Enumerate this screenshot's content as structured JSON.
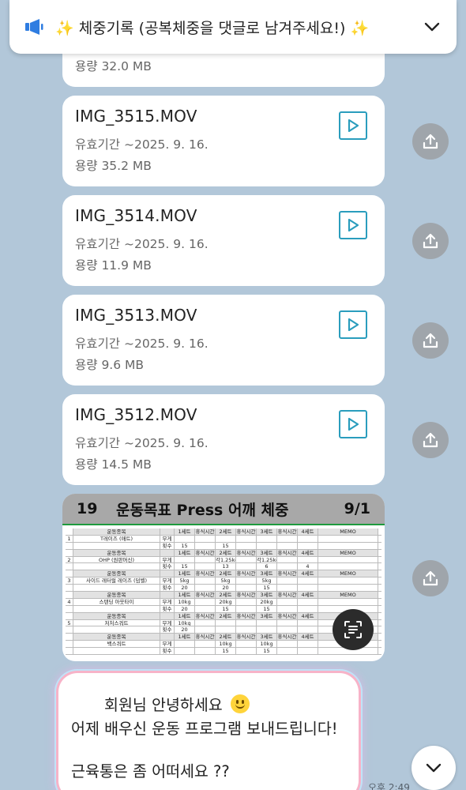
{
  "notice": {
    "text": "✨ 체중기록 (공복체중을 댓글로 남겨주세요!) ✨"
  },
  "top_file": {
    "size": "용량 32.0 MB"
  },
  "files": [
    {
      "name": "IMG_3515.MOV",
      "expiry": "유효기간 ~2025. 9. 16.",
      "size": "용량 35.2 MB"
    },
    {
      "name": "IMG_3514.MOV",
      "expiry": "유효기간 ~2025. 9. 16.",
      "size": "용량 11.9 MB"
    },
    {
      "name": "IMG_3513.MOV",
      "expiry": "유효기간 ~2025. 9. 16.",
      "size": "용량 9.6 MB"
    },
    {
      "name": "IMG_3512.MOV",
      "expiry": "유효기간 ~2025. 9. 16.",
      "size": "용량 14.5 MB"
    }
  ],
  "image_message": {
    "header_num": "19",
    "header_goal": "운동목표  Press 어깨  체중",
    "header_date": "9/1",
    "rows": [
      [
        "",
        "운동종목",
        "",
        "1세트",
        "휴식시간",
        "2세트",
        "휴식시간",
        "3세트",
        "휴식시간",
        "4세트",
        "MEMO"
      ],
      [
        "1",
        "T레이즈 (매트)",
        "무게",
        "",
        "",
        "",
        "",
        "",
        "",
        "",
        ""
      ],
      [
        "",
        "",
        "횟수",
        "15",
        "",
        "15",
        "",
        "",
        "",
        "",
        ""
      ],
      [
        "",
        "운동종목",
        "",
        "1세트",
        "휴식시간",
        "2세트",
        "휴식시간",
        "3세트",
        "휴식시간",
        "4세트",
        "MEMO"
      ],
      [
        "2",
        "OHP (원판머신)",
        "무게",
        "",
        "",
        "각1.25kg",
        "",
        "각1.25kg",
        "",
        "",
        ""
      ],
      [
        "",
        "",
        "횟수",
        "15",
        "",
        "13",
        "",
        "6",
        "",
        "4",
        ""
      ],
      [
        "",
        "운동종목",
        "",
        "1세트",
        "휴식시간",
        "2세트",
        "휴식시간",
        "3세트",
        "휴식시간",
        "4세트",
        "MEMO"
      ],
      [
        "3",
        "사이드 레터럴 레이즈 (덤벨)",
        "무게",
        "5kg",
        "",
        "5kg",
        "",
        "5kg",
        "",
        "",
        ""
      ],
      [
        "",
        "",
        "횟수",
        "20",
        "",
        "20",
        "",
        "15",
        "",
        "",
        ""
      ],
      [
        "",
        "운동종목",
        "",
        "1세트",
        "휴식시간",
        "2세트",
        "휴식시간",
        "3세트",
        "휴식시간",
        "4세트",
        "MEMO"
      ],
      [
        "4",
        "스탠딩 아웃타이",
        "무게",
        "10kg",
        "",
        "20kg",
        "",
        "20kg",
        "",
        "",
        ""
      ],
      [
        "",
        "",
        "횟수",
        "20",
        "",
        "15",
        "",
        "15",
        "",
        "",
        ""
      ],
      [
        "",
        "운동종목",
        "",
        "1세트",
        "휴식시간",
        "2세트",
        "휴식시간",
        "3세트",
        "휴식시간",
        "4세트",
        "MEMO"
      ],
      [
        "5",
        "저처스쿼트",
        "무게",
        "10kg",
        "",
        "",
        "",
        "",
        "",
        "",
        ""
      ],
      [
        "",
        "",
        "횟수",
        "20",
        "",
        "",
        "",
        "",
        "",
        "",
        ""
      ],
      [
        "",
        "운동종목",
        "",
        "1세트",
        "휴식시간",
        "2세트",
        "휴식시간",
        "3세트",
        "휴식시간",
        "4세트",
        "MEMO"
      ],
      [
        "",
        "백스쿼트",
        "무게",
        "",
        "",
        "10kg",
        "",
        "10kg",
        "",
        "",
        ""
      ],
      [
        "",
        "",
        "횟수",
        "",
        "",
        "15",
        "",
        "15",
        "",
        "",
        ""
      ]
    ]
  },
  "bubble": {
    "line1": "회원님 안녕하세요",
    "line2": "어제 배우신 운동 프로그램 보내드립니다!",
    "line3": "근육통은 좀 어떠세요 ??"
  },
  "time": "오후 2:49",
  "colors": {
    "chat_bg": "#b2c7d9",
    "play_accent": "#2a9dbd",
    "notice_icon": "#2f7de1"
  }
}
